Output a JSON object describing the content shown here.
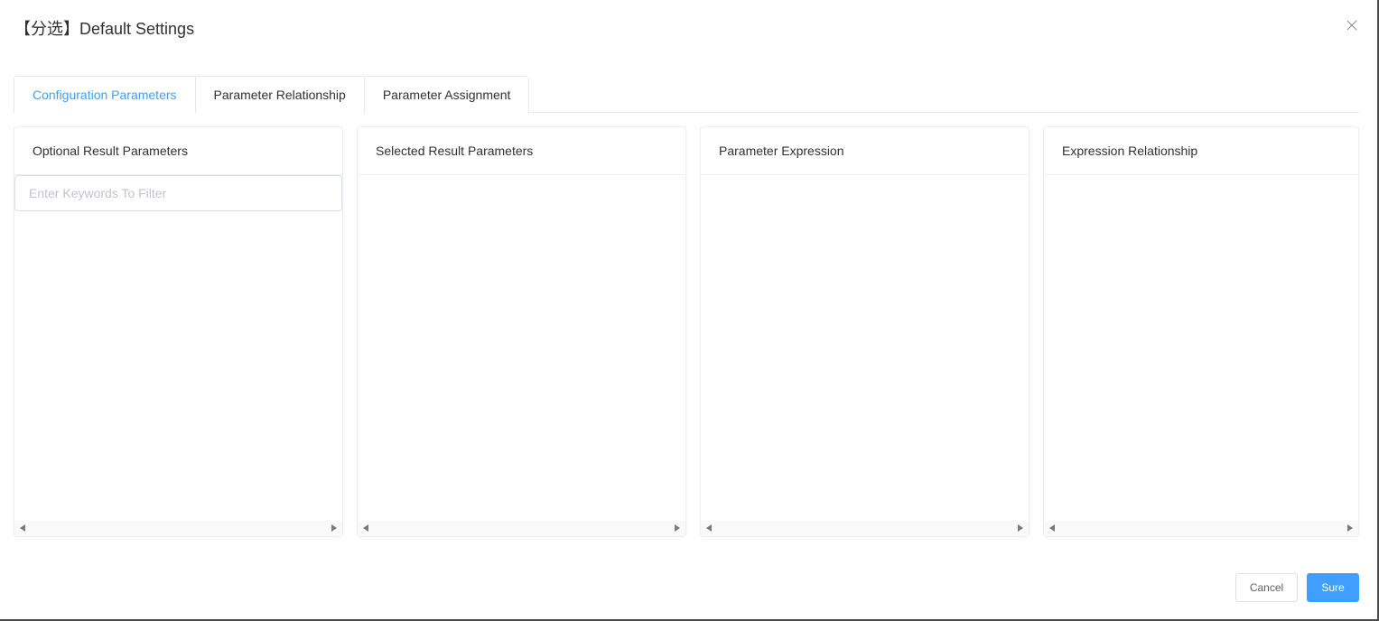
{
  "dialog": {
    "title": "【分选】Default Settings",
    "close_icon": "close-icon"
  },
  "tabs": [
    {
      "label": "Configuration Parameters",
      "active": true
    },
    {
      "label": "Parameter Relationship",
      "active": false
    },
    {
      "label": "Parameter Assignment",
      "active": false
    }
  ],
  "panels": [
    {
      "title": "Optional Result Parameters"
    },
    {
      "title": "Selected Result Parameters"
    },
    {
      "title": "Parameter Expression"
    },
    {
      "title": "Expression Relationship"
    }
  ],
  "filter": {
    "placeholder": "Enter Keywords To Filter",
    "value": ""
  },
  "footer": {
    "cancel_label": "Cancel",
    "sure_label": "Sure"
  },
  "colors": {
    "accent": "#409eff",
    "text": "#303133",
    "border": "#ebeef5"
  }
}
